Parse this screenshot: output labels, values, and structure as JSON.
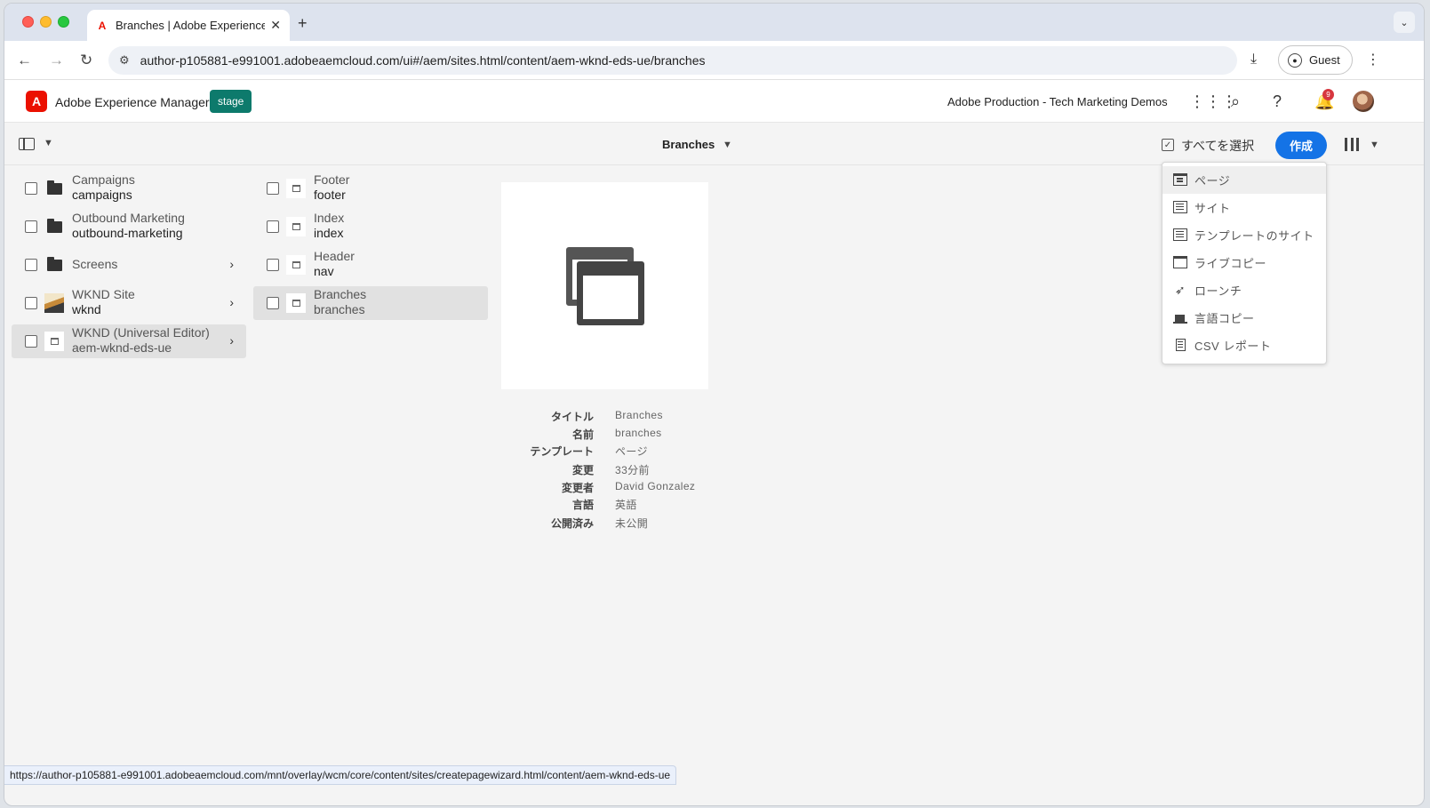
{
  "browser": {
    "tab_title": "Branches | Adobe Experience",
    "new_tab": "+",
    "tab_close": "✕",
    "url": "author-p105881-e991001.adobeaemcloud.com/ui#/aem/sites.html/content/aem-wknd-eds-ue/branches",
    "profile_label": "Guest",
    "status_url": "https://author-p105881-e991001.adobeaemcloud.com/mnt/overlay/wcm/core/content/sites/createpagewizard.html/content/aem-wknd-eds-ue"
  },
  "aem": {
    "product_name": "Adobe Experience Manager",
    "env_badge": "stage",
    "org_name": "Adobe Production - Tech Marketing Demos",
    "notification_count": "9"
  },
  "actionbar": {
    "view_title": "Branches",
    "select_all_label": "すべてを選択",
    "create_label": "作成"
  },
  "column1": [
    {
      "title": "Campaigns",
      "name": "campaigns",
      "icon": "folder-icon",
      "has_children": false,
      "selected": false
    },
    {
      "title": "Outbound Marketing",
      "name": "outbound-marketing",
      "icon": "folder-icon",
      "has_children": false,
      "selected": false
    },
    {
      "title": "Screens",
      "name": "",
      "icon": "folder-icon",
      "has_children": true,
      "selected": false
    },
    {
      "title": "WKND Site",
      "name": "wknd",
      "icon": "site-thumbnail",
      "has_children": true,
      "selected": false
    },
    {
      "title": "WKND (Universal Editor)",
      "name": "aem-wknd-eds-ue",
      "icon": "page-icon",
      "has_children": true,
      "selected": true
    }
  ],
  "column2": [
    {
      "title": "Footer",
      "name": "footer"
    },
    {
      "title": "Index",
      "name": "index"
    },
    {
      "title": "Header",
      "name": "nav"
    },
    {
      "title": "Branches",
      "name": "branches"
    }
  ],
  "details": [
    {
      "key": "タイトル",
      "value": "Branches"
    },
    {
      "key": "名前",
      "value": "branches"
    },
    {
      "key": "テンプレート",
      "value": "ページ"
    },
    {
      "key": "変更",
      "value": "33分前"
    },
    {
      "key": "変更者",
      "value": "David Gonzalez"
    },
    {
      "key": "言語",
      "value": "英語"
    },
    {
      "key": "公開済み",
      "value": "未公開"
    }
  ],
  "create_menu": [
    {
      "label": "ページ",
      "icon": "page-icon"
    },
    {
      "label": "サイト",
      "icon": "site-icon"
    },
    {
      "label": "テンプレートのサイト",
      "icon": "site-template-icon"
    },
    {
      "label": "ライブコピー",
      "icon": "live-copy-icon"
    },
    {
      "label": "ローンチ",
      "icon": "launch-icon"
    },
    {
      "label": "言語コピー",
      "icon": "language-copy-icon"
    },
    {
      "label": "CSV レポート",
      "icon": "csv-report-icon"
    }
  ],
  "colors": {
    "accent": "#1473e6",
    "stage_badge": "#0d7a6c",
    "brand": "#eb1000"
  }
}
